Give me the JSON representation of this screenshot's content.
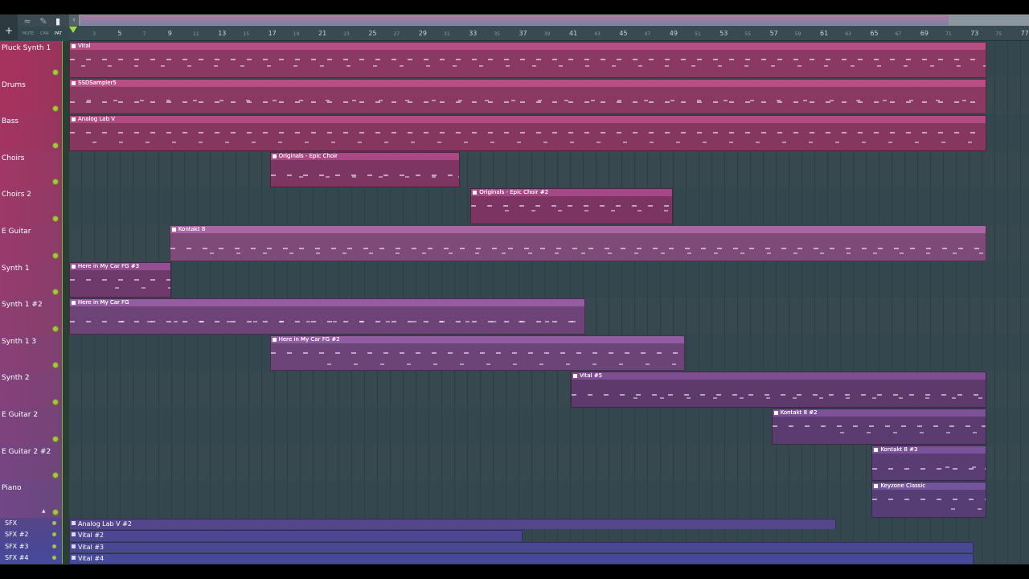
{
  "toolbar": {
    "add_label": "+",
    "modes": [
      "MUTE",
      "CAN",
      "PAT"
    ]
  },
  "ruler": {
    "bars": [
      "3",
      "5",
      "7",
      "9",
      "11",
      "13",
      "15",
      "17",
      "19",
      "21",
      "23",
      "25",
      "27",
      "29",
      "31",
      "33",
      "35",
      "37",
      "39",
      "41",
      "43",
      "45",
      "47",
      "49",
      "51",
      "53",
      "55",
      "57",
      "59",
      "61",
      "63",
      "65",
      "67",
      "69",
      "71",
      "73",
      "75",
      "77"
    ]
  },
  "tracks": [
    {
      "name": "Pluck Synth 1",
      "color": "#a8325e",
      "clips": [
        {
          "label": "Vital",
          "start": 1,
          "end": 74,
          "color": "#8a3a62"
        }
      ]
    },
    {
      "name": "Drums",
      "color": "#a8325e",
      "clips": [
        {
          "label": "SSDSampler5",
          "start": 1,
          "end": 74,
          "color": "#8a3a62"
        }
      ]
    },
    {
      "name": "Bass",
      "color": "#a43462",
      "clips": [
        {
          "label": "Analog Lab V",
          "start": 1,
          "end": 74,
          "color": "#853760"
        }
      ]
    },
    {
      "name": "Choirs",
      "color": "#a23766",
      "clips": [
        {
          "label": "Originals - Epic Choir",
          "start": 17,
          "end": 32,
          "color": "#7d3562"
        }
      ]
    },
    {
      "name": "Choirs 2",
      "color": "#9e3868",
      "clips": [
        {
          "label": "Originals - Epic Choir #2",
          "start": 33,
          "end": 49,
          "color": "#7c3563"
        }
      ]
    },
    {
      "name": " E Guitar",
      "color": "#9a3a6c",
      "clips": [
        {
          "label": "Kontakt 8",
          "start": 9,
          "end": 74,
          "color": "#7e4a78"
        }
      ]
    },
    {
      "name": "Synth 1",
      "color": "#963c6e",
      "clips": [
        {
          "label": "Here in My Car FG #3",
          "start": 1,
          "end": 9,
          "color": "#6e3a6c"
        }
      ]
    },
    {
      "name": "Synth 1 #2",
      "color": "#903e72",
      "clips": [
        {
          "label": "Here in My Car FG",
          "start": 1,
          "end": 42,
          "color": "#6e4478"
        }
      ]
    },
    {
      "name": "Synth 1 3",
      "color": "#8a4076",
      "clips": [
        {
          "label": "Here in My Car FG #2",
          "start": 17,
          "end": 50,
          "color": "#6c4478"
        }
      ]
    },
    {
      "name": "Synth 2",
      "color": "#85417a",
      "clips": [
        {
          "label": "Vital #5",
          "start": 41,
          "end": 74,
          "color": "#5e3a6c"
        }
      ]
    },
    {
      "name": "E Guitar 2",
      "color": "#7e437e",
      "clips": [
        {
          "label": "Kontakt 8 #2",
          "start": 57,
          "end": 74,
          "color": "#5c3c70"
        }
      ]
    },
    {
      "name": "E Guitar 2 #2",
      "color": "#784582",
      "clips": [
        {
          "label": "Kontakt 8 #3",
          "start": 65,
          "end": 74,
          "color": "#5a3c72"
        }
      ]
    },
    {
      "name": "Piano",
      "color": "#714786",
      "clips": [
        {
          "label": "Keyzone Classic",
          "start": 65,
          "end": 74,
          "color": "#563e74"
        }
      ]
    }
  ],
  "sfx_tracks": [
    {
      "name": "SFX",
      "clip": "Analog Lab V #2",
      "start": 1,
      "end": 62,
      "color": "#55458a"
    },
    {
      "name": "SFX #2",
      "clip": "Vital #2",
      "start": 1,
      "end": 37,
      "color": "#4f4690"
    },
    {
      "name": "SFX #3",
      "clip": "Vital #3",
      "start": 1,
      "end": 73,
      "color": "#4a4894"
    },
    {
      "name": "SFX #4",
      "clip": "Vital #4",
      "start": 1,
      "end": 73,
      "color": "#464a98"
    }
  ]
}
